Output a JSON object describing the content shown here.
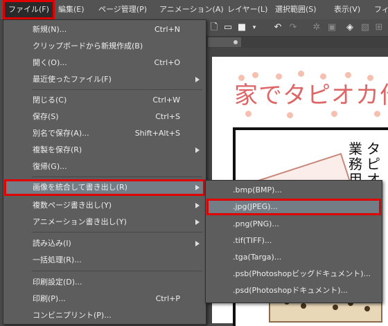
{
  "menubar": {
    "items": [
      "ファイル(F)",
      "編集(E)",
      "ページ管理(P)",
      "アニメーション(A)",
      "レイヤー(L)",
      "選択範囲(S)",
      "表示(V)",
      "フィ"
    ]
  },
  "file_menu": {
    "items": [
      {
        "label": "新規(N)...",
        "shortcut": "Ctrl+N"
      },
      {
        "label": "クリップボードから新規作成(B)",
        "shortcut": ""
      },
      {
        "label": "開く(O)...",
        "shortcut": "Ctrl+O"
      },
      {
        "label": "最近使ったファイル(F)",
        "shortcut": ""
      },
      {
        "label": "閉じる(C)",
        "shortcut": "Ctrl+W"
      },
      {
        "label": "保存(S)",
        "shortcut": "Ctrl+S"
      },
      {
        "label": "別名で保存(A)...",
        "shortcut": "Shift+Alt+S"
      },
      {
        "label": "複製を保存(R)",
        "shortcut": ""
      },
      {
        "label": "復帰(G)...",
        "shortcut": ""
      },
      {
        "label": "画像を統合して書き出し(R)",
        "shortcut": ""
      },
      {
        "label": "複数ページ書き出し(Y)",
        "shortcut": ""
      },
      {
        "label": "アニメーション書き出し(Y)",
        "shortcut": ""
      },
      {
        "label": "読み込み(I)",
        "shortcut": ""
      },
      {
        "label": "一括処理(R)...",
        "shortcut": ""
      },
      {
        "label": "印刷設定(D)...",
        "shortcut": ""
      },
      {
        "label": "印刷(P)...",
        "shortcut": "Ctrl+P"
      },
      {
        "label": "コンビニプリント(P)...",
        "shortcut": ""
      }
    ]
  },
  "export_submenu": {
    "items": [
      ".bmp(BMP)...",
      ".jpg(JPEG)...",
      ".png(PNG)...",
      ".tif(TIFF)...",
      ".tga(Targa)...",
      ".psb(Photoshopビッグドキュメント)...",
      ".psd(Photoshopドキュメント)..."
    ]
  },
  "canvas": {
    "title_text": "家でタピオカ作",
    "vertical_col1": "タピオ",
    "vertical_col2": "業務用"
  },
  "colors": {
    "highlight_outline": "#e00000",
    "menu_bg": "#5d5d5d",
    "hover_bg": "#727d86"
  }
}
